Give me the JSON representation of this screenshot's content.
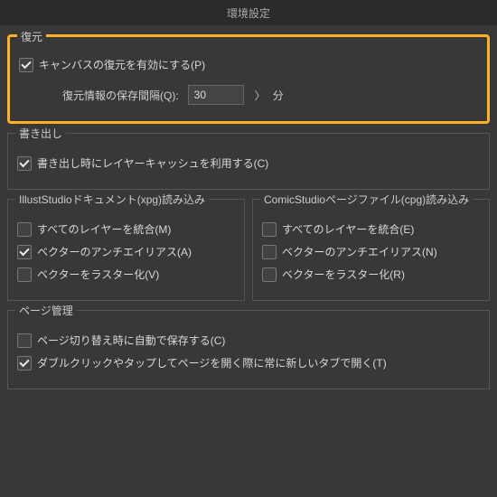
{
  "title": "環境設定",
  "recovery": {
    "legend": "復元",
    "enable_label": "キャンバスの復元を有効にする(P)",
    "enable_checked": true,
    "interval_label": "復元情報の保存間隔(Q):",
    "interval_value": "30",
    "interval_unit": "分"
  },
  "export": {
    "legend": "書き出し",
    "layer_cache_label": "書き出し時にレイヤーキャッシュを利用する(C)",
    "layer_cache_checked": true
  },
  "illust": {
    "legend": "IllustStudioドキュメント(xpg)読み込み",
    "merge_label": "すべてのレイヤーを統合(M)",
    "merge_checked": false,
    "aa_label": "ベクターのアンチエイリアス(A)",
    "aa_checked": true,
    "raster_label": "ベクターをラスター化(V)",
    "raster_checked": false
  },
  "comic": {
    "legend": "ComicStudioページファイル(cpg)読み込み",
    "merge_label": "すべてのレイヤーを統合(E)",
    "merge_checked": false,
    "aa_label": "ベクターのアンチエイリアス(N)",
    "aa_checked": false,
    "raster_label": "ベクターをラスター化(R)",
    "raster_checked": false
  },
  "page": {
    "legend": "ページ管理",
    "autosave_label": "ページ切り替え時に自動で保存する(C)",
    "autosave_checked": false,
    "newtab_label": "ダブルクリックやタップしてページを開く際に常に新しいタブで開く(T)",
    "newtab_checked": true
  }
}
